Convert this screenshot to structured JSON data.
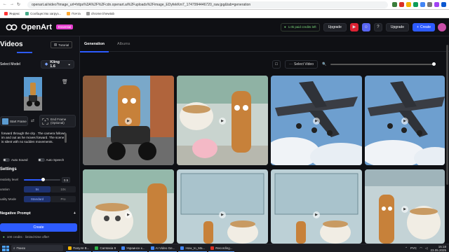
{
  "browser": {
    "url": "openart.ai/video?image_url=https%3A%2F%2Fcdn.openart.ai%2Fuploads%2Fimage_EDyfekKm7_1747994446720_raw.jpg&tab=generation",
    "bookmarks": [
      "Яндекс",
      "Cообщество загруз...",
      "Почта",
      "chrome://newtab"
    ]
  },
  "header": {
    "brand": "OpenArt",
    "badge": "Essential",
    "credits_pill": "1.0k paid credits left",
    "upgrade_label": "Upgrade",
    "upgrade2_label": "Upgrade",
    "create_label": "Create"
  },
  "sidebar": {
    "title": "Videos",
    "tutorial_label": "Tutorial",
    "model_label": "Select Model",
    "model_value": "Kling 1.6",
    "start_frame_label": "Start Frame",
    "end_frame_label_1": "End Frame",
    "end_frame_label_2": "(Optional)",
    "prompt_lines": [
      "forward through the city . The camera follows",
      "im and out as he moves forward. The scene",
      "is silent with no sudden movements."
    ],
    "auto_sound": "Auto Sound",
    "auto_speech": "Auto Speech",
    "settings_title": "Settings",
    "creativity_label": "reativity level",
    "creativity_value": "0.5",
    "duration_label": "uration",
    "duration_options": [
      "5s",
      "10s"
    ],
    "quality_label": "uality Mode",
    "quality_options": [
      "Standard",
      "Pro"
    ],
    "negative_prompt_label": "Negative Prompt",
    "create_label": "Create",
    "credits_line": "100 credits · limited-time offer!"
  },
  "content": {
    "tabs": [
      "Generation",
      "Albums"
    ],
    "select_video_label": "Select Video"
  },
  "taskbar": {
    "search_label": "Поиск",
    "apps": [
      "Папуля В...",
      "Camtasia 9",
      "Украинсн к...",
      "AI Video Ge...",
      "How_to_Ma...",
      "Recording..."
    ],
    "lang": "РУС",
    "time": "15:18",
    "date": "23.05.2025"
  },
  "colors": {
    "accent": "#2d5bff",
    "badge": "#e73dd0",
    "credits": "#7bd97b"
  }
}
